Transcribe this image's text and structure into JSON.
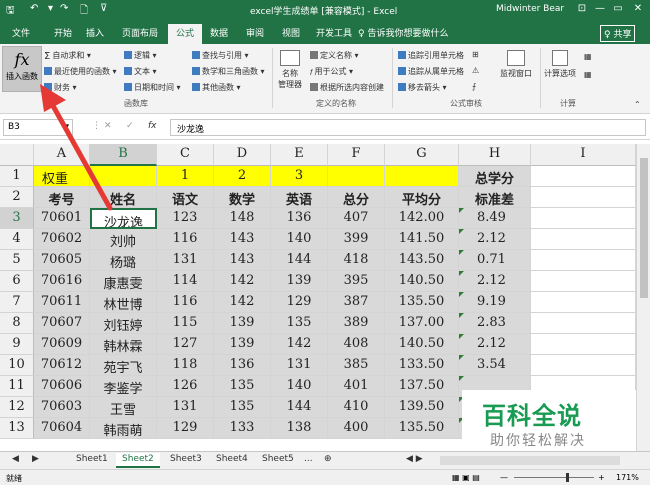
{
  "titlebar": {
    "title": "excel学生成绩单  [兼容模式] - Excel",
    "user": "Midwinter Bear",
    "minimize": "—",
    "restore": "▭",
    "close": "✕",
    "ribbon_opts": "⊡"
  },
  "tabs": [
    "文件",
    "开始",
    "插入",
    "页面布局",
    "公式",
    "数据",
    "审阅",
    "视图",
    "开发工具"
  ],
  "active_tab": "公式",
  "tell_me": "♀ 告诉我你想要做什么",
  "share": "♀ 共享",
  "ribbon": {
    "insert_function": "插入函数",
    "fx": "fx",
    "library": {
      "autosum": "自动求和 ▾",
      "recent": "最近使用的函数 ▾",
      "financial": "财务 ▾",
      "logical": "逻辑 ▾",
      "text": "文本 ▾",
      "datetime": "日期和时间 ▾",
      "lookup": "查找与引用 ▾",
      "math": "数学和三角函数 ▾",
      "more": "其他函数 ▾",
      "group": "函数库"
    },
    "names": {
      "manager_l1": "名称",
      "manager_l2": "管理器",
      "define": "定义名称 ▾",
      "use": "用于公式 ▾",
      "create": "根据所选内容创建",
      "group": "定义的名称"
    },
    "audit": {
      "trace_prec": "追踪引用单元格",
      "trace_dep": "追踪从属单元格",
      "remove": "移去箭头 ▾",
      "watch": "监视窗口",
      "group": "公式审核"
    },
    "calc": {
      "options_l1": "计算选项",
      "group": "计算"
    }
  },
  "formula_bar": {
    "name_box": "B3",
    "name_dropdown": "▾",
    "dots": "⋮",
    "cancel": "✕",
    "confirm": "✓",
    "fx": "fx",
    "value": "沙龙逸"
  },
  "columns": [
    "A",
    "B",
    "C",
    "D",
    "E",
    "F",
    "G",
    "H",
    "I"
  ],
  "rows": [
    "1",
    "2",
    "3",
    "4",
    "5",
    "6",
    "7",
    "8",
    "9",
    "10",
    "11",
    "12",
    "13"
  ],
  "sheet": {
    "row1": [
      "权重",
      "",
      "1",
      "2",
      "3",
      "",
      "",
      "总学分",
      ""
    ],
    "row2": [
      "考号",
      "姓名",
      "语文",
      "数学",
      "英语",
      "总分",
      "平均分",
      "标准差",
      ""
    ],
    "data": [
      [
        "70601",
        "沙龙逸",
        "123",
        "148",
        "136",
        "407",
        "142.00",
        "8.49"
      ],
      [
        "70602",
        "刘帅",
        "116",
        "143",
        "140",
        "399",
        "141.50",
        "2.12"
      ],
      [
        "70605",
        "杨璐",
        "131",
        "143",
        "144",
        "418",
        "143.50",
        "0.71"
      ],
      [
        "70616",
        "康惠雯",
        "114",
        "142",
        "139",
        "395",
        "140.50",
        "2.12"
      ],
      [
        "70611",
        "林世博",
        "116",
        "142",
        "129",
        "387",
        "135.50",
        "9.19"
      ],
      [
        "70607",
        "刘钰婷",
        "115",
        "139",
        "135",
        "389",
        "137.00",
        "2.83"
      ],
      [
        "70609",
        "韩林霖",
        "127",
        "139",
        "142",
        "408",
        "140.50",
        "2.12"
      ],
      [
        "70612",
        "苑宇飞",
        "118",
        "136",
        "131",
        "385",
        "133.50",
        "3.54"
      ],
      [
        "70606",
        "李鉴学",
        "126",
        "135",
        "140",
        "401",
        "137.50",
        ""
      ],
      [
        "70603",
        "王雪",
        "131",
        "135",
        "144",
        "410",
        "139.50",
        ""
      ],
      [
        "70604",
        "韩雨萌",
        "129",
        "133",
        "138",
        "400",
        "135.50",
        ""
      ]
    ]
  },
  "sheet_tabs": [
    "Sheet1",
    "Sheet2",
    "Sheet3",
    "Sheet4",
    "Sheet5"
  ],
  "active_sheet": "Sheet2",
  "sheet_nav": {
    "prev": "◀",
    "next": "▶",
    "more": "...",
    "add": "⊕",
    "hscroll": "◀ ▶"
  },
  "status": {
    "ready": "就绪",
    "zoom": "171%",
    "views": "▦ ▣ ▤",
    "zoom_minus": "—",
    "zoom_plus": "+"
  },
  "watermark": {
    "line1": "百科全说",
    "line2": "助你轻松解决"
  },
  "colors": {
    "excel_green": "#217346",
    "yellow": "#ffff00",
    "arrow_red": "#e53935",
    "watermark_green": "#1a9b53"
  }
}
